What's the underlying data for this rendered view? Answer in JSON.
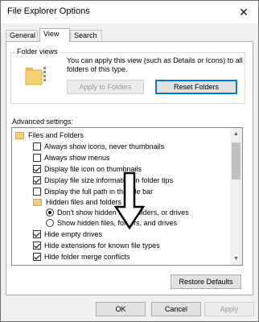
{
  "window": {
    "title": "File Explorer Options",
    "close_glyph": "✕"
  },
  "tabs": [
    {
      "label": "General"
    },
    {
      "label": "View"
    },
    {
      "label": "Search"
    }
  ],
  "folder_views": {
    "group_label": "Folder views",
    "description": "You can apply this view (such as Details or Icons) to all folders of this type.",
    "apply_label": "Apply to Folders",
    "reset_label": "Reset Folders"
  },
  "advanced": {
    "label": "Advanced settings:",
    "items": [
      {
        "type": "folder",
        "label": "Files and Folders"
      },
      {
        "type": "checkbox",
        "checked": false,
        "label": "Always show icons, never thumbnails"
      },
      {
        "type": "checkbox",
        "checked": false,
        "label": "Always show menus"
      },
      {
        "type": "checkbox",
        "checked": true,
        "label": "Display file icon on thumbnails"
      },
      {
        "type": "checkbox",
        "checked": true,
        "label": "Display file size information in folder tips"
      },
      {
        "type": "checkbox",
        "checked": false,
        "label": "Display the full path in the title bar"
      },
      {
        "type": "folder",
        "label": "Hidden files and folders"
      },
      {
        "type": "radio",
        "checked": true,
        "label": "Don't show hidden files, folders, or drives"
      },
      {
        "type": "radio",
        "checked": false,
        "label": "Show hidden files, folders, and drives"
      },
      {
        "type": "checkbox",
        "checked": true,
        "label": "Hide empty drives"
      },
      {
        "type": "checkbox",
        "checked": true,
        "label": "Hide extensions for known file types"
      },
      {
        "type": "checkbox",
        "checked": true,
        "label": "Hide folder merge conflicts"
      }
    ]
  },
  "restore_defaults_label": "Restore Defaults",
  "footer": {
    "ok_label": "OK",
    "cancel_label": "Cancel",
    "apply_label": "Apply"
  },
  "colors": {
    "focus": "#0078d7",
    "folder": "#f4d077"
  }
}
